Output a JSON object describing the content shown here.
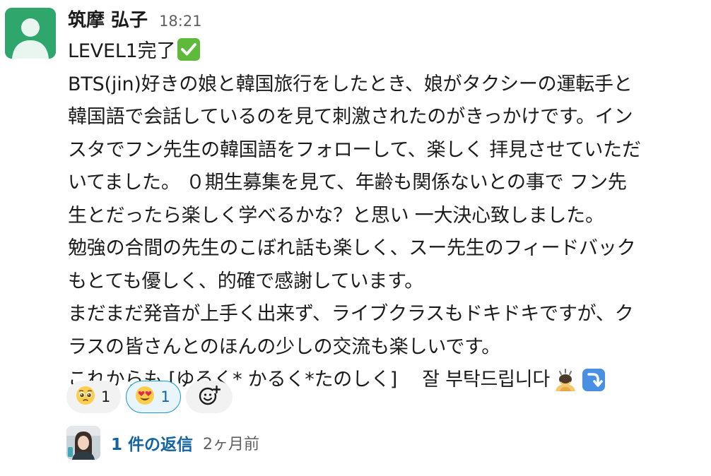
{
  "message": {
    "sender": "筑摩 弘子",
    "time": "18:21",
    "lines": [
      "LEVEL1完了",
      "BTS(jin)好きの娘と韓国旅行をしたとき、娘がタクシーの運転手と",
      "韓国語で会話しているのを見て刺激されたのがきっかけです。イン",
      "スタでフン先生の韓国語をフォローして、楽しく 拝見させていただ",
      "いてました。 ０期生募集を見て、年齢も関係ないとの事で フン先",
      "生とだったら楽しく学べるかな？と思い 一大決心致しました。",
      "勉強の合間の先生のこぼれ話も楽しく、スー先生のフィードバック",
      "もとても優しく、的確で感謝しています。",
      "まだまだ発音が上手く出来ず、ライブクラスもドキドキですが、ク",
      "ラスの皆さんとのほんの少しの交流も楽しいです。",
      "これからも [ゆるく* かるく*たのしく]　 잘 부탁드립니다"
    ],
    "inline_emojis": {
      "after_line_1": "white-check-mark",
      "after_last_line": [
        "person-bowing",
        "arrow-down-right"
      ]
    }
  },
  "reactions": [
    {
      "emoji": "pleading-face",
      "count": "1",
      "selected": false
    },
    {
      "emoji": "heart-eyes-face",
      "count": "1",
      "selected": true
    }
  ],
  "add_reaction": {
    "icon": "add-reaction-icon"
  },
  "thread": {
    "reply_label": "1 件の返信",
    "reply_time": "2ヶ月前"
  },
  "colors": {
    "link": "#1264a3",
    "muted": "#616061",
    "text": "#1d1c1d",
    "selected_border": "#1d9bd1",
    "avatar_bg": "#2fa66c"
  }
}
